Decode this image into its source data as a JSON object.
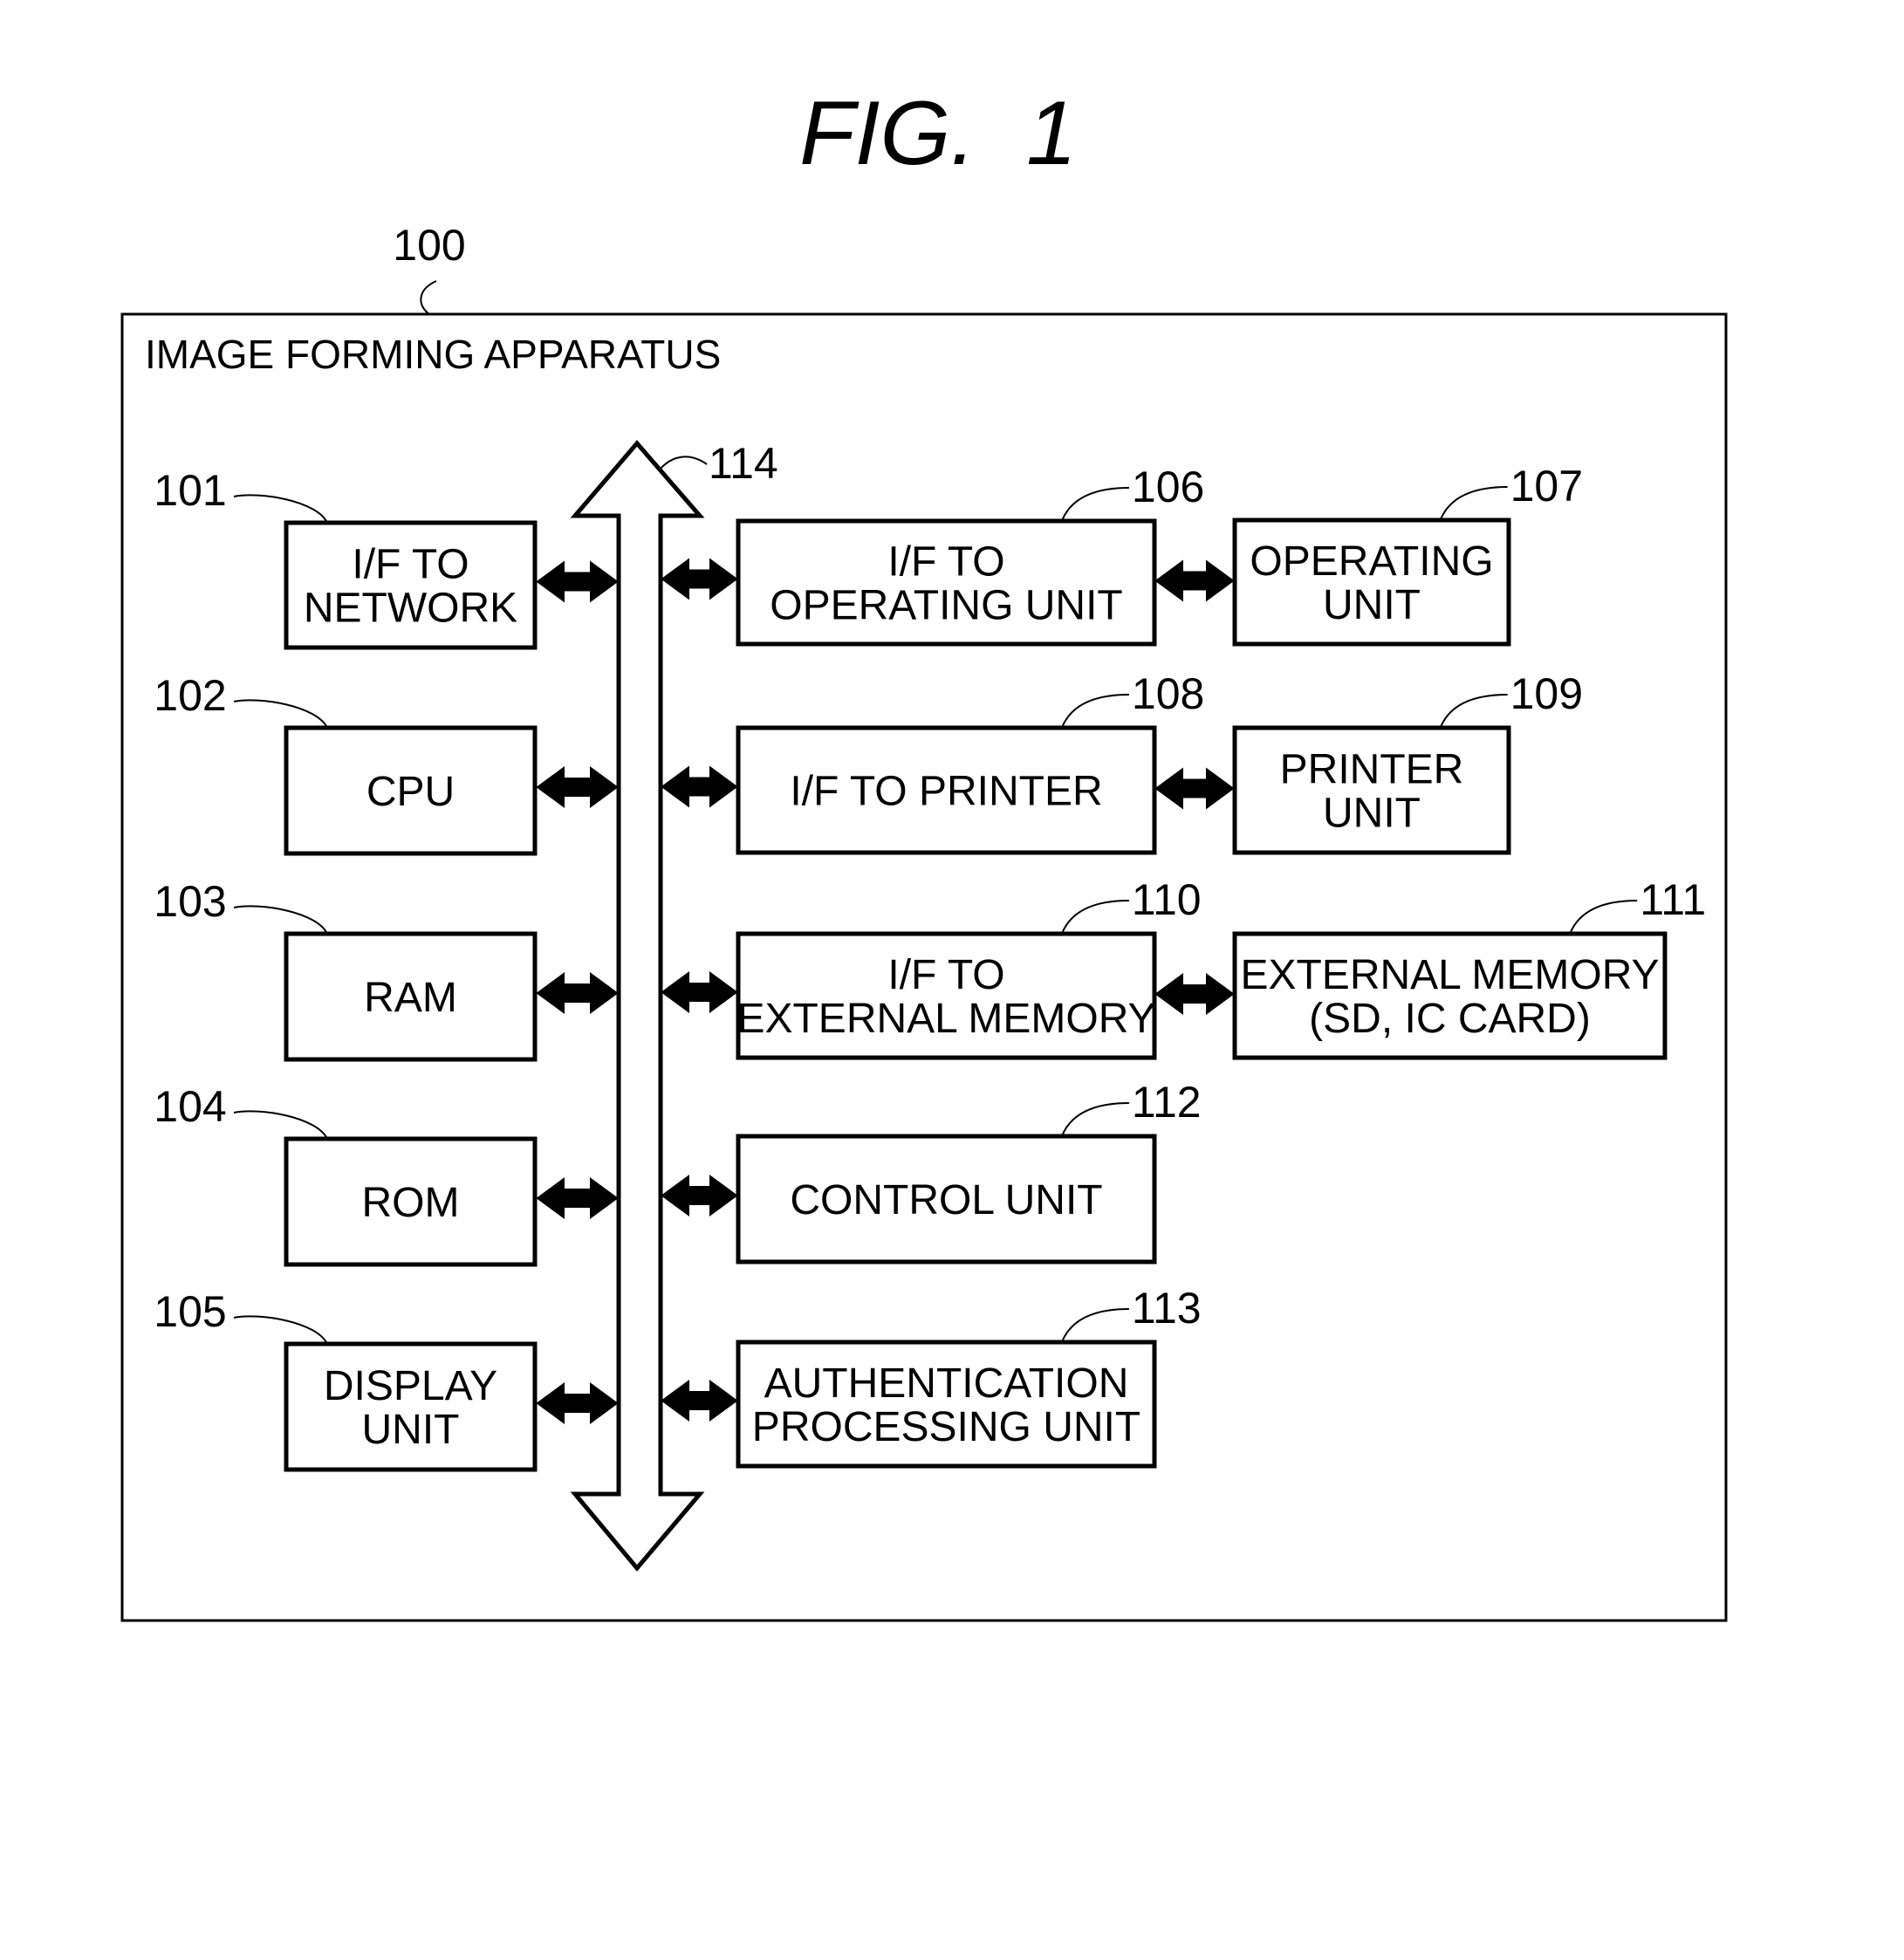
{
  "figure": {
    "title": "FIG.  1"
  },
  "apparatus": {
    "ref": "100",
    "label": "IMAGE FORMING APPARATUS"
  },
  "bus": {
    "ref": "114"
  },
  "left_blocks": [
    {
      "ref": "101",
      "lines": [
        "I/F TO",
        "NETWORK"
      ]
    },
    {
      "ref": "102",
      "lines": [
        "CPU"
      ]
    },
    {
      "ref": "103",
      "lines": [
        "RAM"
      ]
    },
    {
      "ref": "104",
      "lines": [
        "ROM"
      ]
    },
    {
      "ref": "105",
      "lines": [
        "DISPLAY",
        "UNIT"
      ]
    }
  ],
  "middle_blocks": [
    {
      "ref": "106",
      "lines": [
        "I/F TO",
        "OPERATING UNIT"
      ]
    },
    {
      "ref": "108",
      "lines": [
        "I/F TO PRINTER"
      ]
    },
    {
      "ref": "110",
      "lines": [
        "I/F TO",
        "EXTERNAL MEMORY"
      ]
    },
    {
      "ref": "112",
      "lines": [
        "CONTROL UNIT"
      ]
    },
    {
      "ref": "113",
      "lines": [
        "AUTHENTICATION",
        "PROCESSING UNIT"
      ]
    }
  ],
  "right_blocks": [
    {
      "ref": "107",
      "lines": [
        "OPERATING",
        "UNIT"
      ]
    },
    {
      "ref": "109",
      "lines": [
        "PRINTER",
        "UNIT"
      ]
    },
    {
      "ref": "111",
      "lines": [
        "EXTERNAL MEMORY",
        "(SD, IC CARD)"
      ]
    }
  ],
  "colors": {
    "stroke": "#000000",
    "background": "#ffffff"
  }
}
